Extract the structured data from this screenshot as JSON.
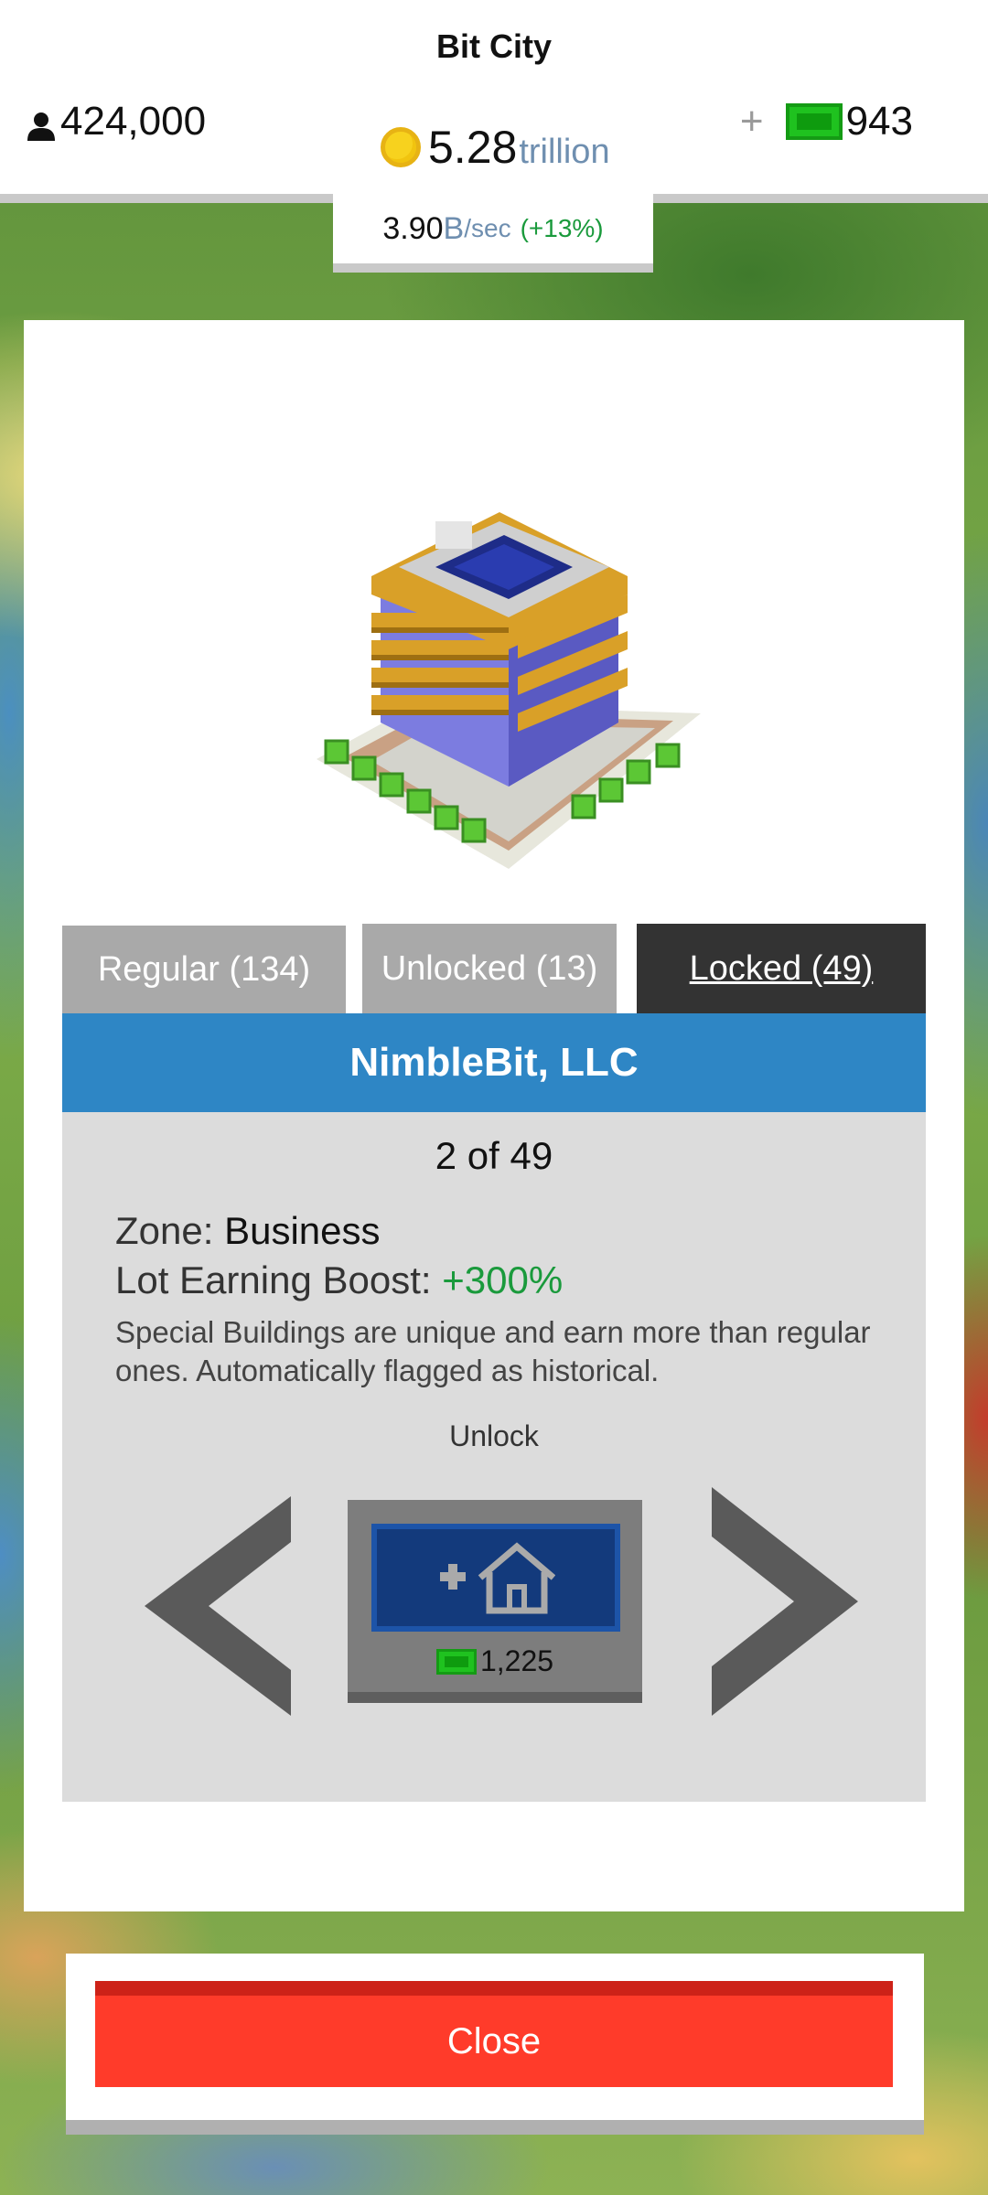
{
  "header": {
    "city_name": "Bit City",
    "population": "424,000",
    "coins_value": "5.28",
    "coins_unit": "trillion",
    "plus": "+",
    "bux": "943",
    "rate_value": "3.90",
    "rate_unit": "B",
    "rate_per": "/sec",
    "rate_boost": "(+13%)"
  },
  "tabs": [
    {
      "label": "Regular (134)"
    },
    {
      "label": "Unlocked (13)"
    },
    {
      "label": "Locked (49)"
    }
  ],
  "building": {
    "name": "NimbleBit, LLC",
    "counter": "2 of 49",
    "zone_label": "Zone: ",
    "zone_value": "Business",
    "boost_label": "Lot Earning Boost: ",
    "boost_value": "+300%",
    "description": "Special Buildings are unique and earn more than regular ones. Automatically flagged as historical."
  },
  "unlock": {
    "label": "Unlock",
    "cost": "1,225"
  },
  "close_label": "Close",
  "colors": {
    "accent_blue": "#2e86c5",
    "green_text": "#1a9a3c",
    "close_red": "#ff3b2a",
    "tab_active": "#333333",
    "tab_inactive": "#a9a9a9"
  },
  "icons": {
    "population": "person-icon",
    "coins": "coin-icon",
    "bux": "bux-icon",
    "unlock": "house-plus-icon",
    "prev": "chevron-left-icon",
    "next": "chevron-right-icon"
  }
}
